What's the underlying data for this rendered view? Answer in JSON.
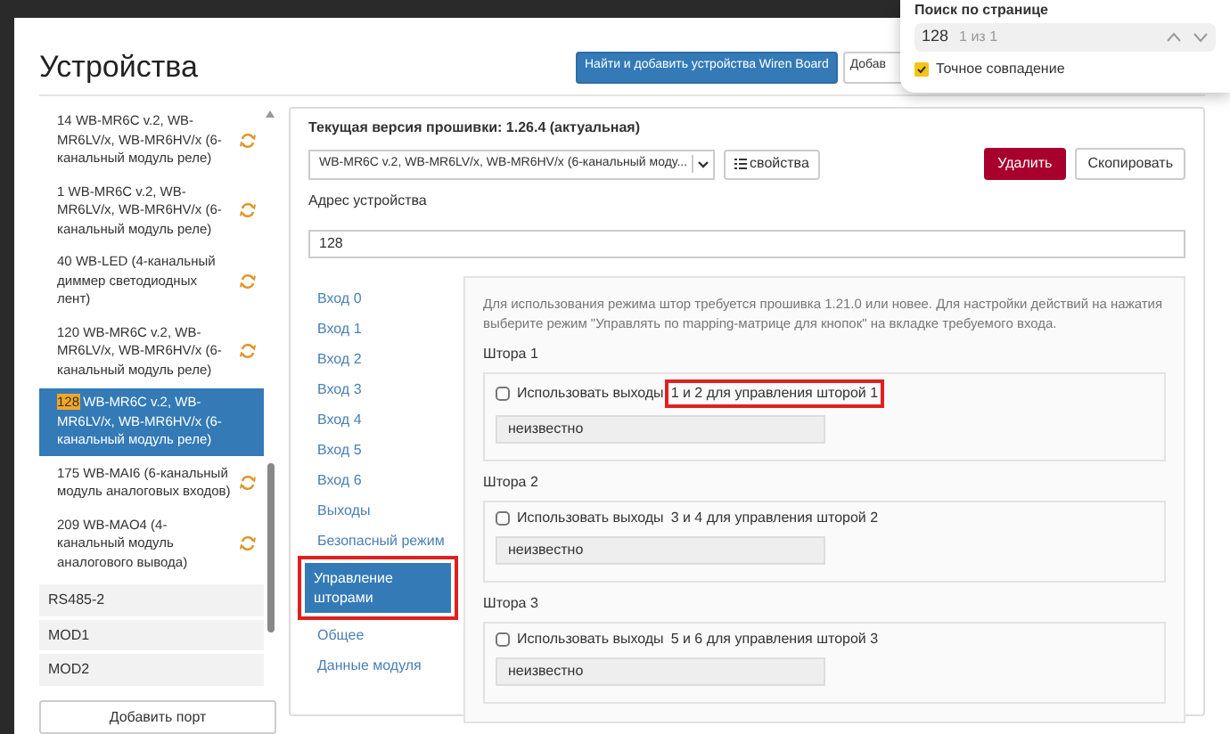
{
  "modal": {
    "title": "Устройства",
    "buttons": [
      {
        "label": "Найти и добавить устройства Wiren Board",
        "kind": "primary"
      },
      {
        "label": "Добав",
        "kind": "default"
      }
    ]
  },
  "sidebar": {
    "devices": [
      {
        "address": "14",
        "name": "WB-MR6C v.2, WB-MR6LV/x, WB-MR6HV/x (6-канальный модуль реле)",
        "selected": false,
        "search_match": false,
        "syncing": true
      },
      {
        "address": "1",
        "name": "WB-MR6C v.2, WB-MR6LV/x, WB-MR6HV/x (6-канальный модуль реле)",
        "selected": false,
        "search_match": false,
        "syncing": true
      },
      {
        "address": "40",
        "name": "WB-LED (4-канальный диммер светодиодных лент)",
        "selected": false,
        "search_match": false,
        "syncing": true
      },
      {
        "address": "120",
        "name": "WB-MR6C v.2, WB-MR6LV/x, WB-MR6HV/x (6-канальный модуль реле)",
        "selected": false,
        "search_match": false,
        "syncing": true
      },
      {
        "address": "128",
        "name": "WB-MR6C v.2, WB-MR6LV/x, WB-MR6HV/x (6-канальный модуль реле)",
        "selected": true,
        "search_match": true,
        "syncing": false
      },
      {
        "address": "175",
        "name": "WB-MAI6 (6-канальный модуль аналоговых входов)",
        "selected": false,
        "search_match": false,
        "syncing": true
      },
      {
        "address": "209",
        "name": "WB-MAO4 (4-канальный модуль аналогового вывода)",
        "selected": false,
        "search_match": false,
        "syncing": true
      }
    ],
    "ports": [
      "RS485-2",
      "MOD1",
      "MOD2"
    ],
    "add_port_button": "Добавить порт"
  },
  "device": {
    "firmware": "Текущая версия прошивки: 1.26.4 (актуальная)",
    "device_type": "WB-MR6C v.2, WB-MR6LV/x, WB-MR6HV/x (6-канальный моду...",
    "properties_button": "свойства",
    "delete_button": "Удалить",
    "copy_button": "Скопировать",
    "address_label": "Адрес устройства",
    "address_value": "128",
    "tabs": [
      {
        "label": "Вход 0",
        "selected": false,
        "highlighted": false
      },
      {
        "label": "Вход 1",
        "selected": false,
        "highlighted": false
      },
      {
        "label": "Вход 2",
        "selected": false,
        "highlighted": false
      },
      {
        "label": "Вход 3",
        "selected": false,
        "highlighted": false
      },
      {
        "label": "Вход 4",
        "selected": false,
        "highlighted": false
      },
      {
        "label": "Вход 5",
        "selected": false,
        "highlighted": false
      },
      {
        "label": "Вход 6",
        "selected": false,
        "highlighted": false
      },
      {
        "label": "Выходы",
        "selected": false,
        "highlighted": false
      },
      {
        "label": "Безопасный режим",
        "selected": false,
        "highlighted": false
      },
      {
        "label": "Управление шторами",
        "selected": true,
        "highlighted": true
      },
      {
        "label": "Общее",
        "selected": false,
        "highlighted": false
      },
      {
        "label": "Данные модуля",
        "selected": false,
        "highlighted": false
      }
    ],
    "note": "Для использования режима штор требуется прошивка 1.21.0 или новее. Для настройки действий на нажатия выберите режим \"Управлять по mapping-матрице для кнопок\" на вкладке требуемого входа.",
    "curtains": [
      {
        "title": "Штора 1",
        "label_start": "Использовать выходы",
        "label_end": "1 и 2 для управления шторой 1",
        "checked": false,
        "highlighted": true,
        "value": "неизвестно"
      },
      {
        "title": "Штора 2",
        "label_start": "Использовать выходы",
        "label_end": "3 и 4 для управления шторой 2",
        "checked": false,
        "highlighted": false,
        "value": "неизвестно"
      },
      {
        "title": "Штора 3",
        "label_start": "Использовать выходы",
        "label_end": "5 и 6 для управления шторой 3",
        "checked": false,
        "highlighted": false,
        "value": "неизвестно"
      }
    ]
  },
  "find_bar": {
    "title": "Поиск по странице",
    "query": "128",
    "count": "1 из 1",
    "exact_match_label": "Точное совпадение",
    "exact_match": true
  }
}
